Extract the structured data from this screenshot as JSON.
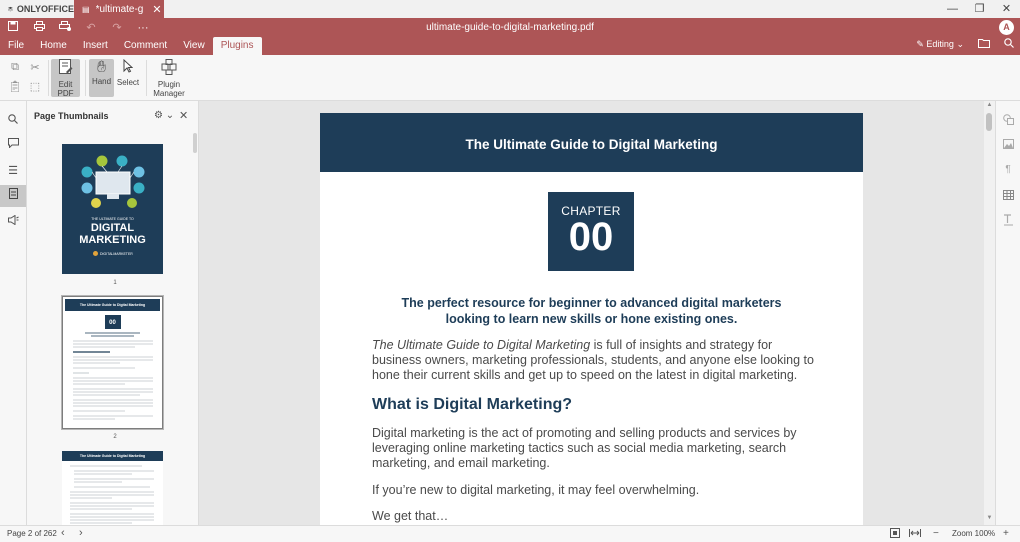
{
  "app": {
    "logo_text": "ONLYOFFICE",
    "tab_label": "*ultimate-g…",
    "doc_title": "ultimate-guide-to-digital-marketing.pdf",
    "avatar": "A",
    "window_controls": [
      "—",
      "❐",
      "✕"
    ]
  },
  "quick_access": [
    "save-icon",
    "print-icon",
    "quick-print-icon",
    "undo-icon",
    "redo-icon",
    "more-icon"
  ],
  "menu": {
    "items": [
      "File",
      "Home",
      "Insert",
      "Comment",
      "View",
      "Plugins"
    ],
    "active": "Plugins",
    "mode_label": "Editing"
  },
  "toolbar": {
    "edit_pdf": "Edit PDF",
    "hand": "Hand",
    "select": "Select",
    "plugin_manager": "Plugin Manager"
  },
  "thumbnails": {
    "title": "Page Thumbnails",
    "page_numbers": [
      "1",
      "2"
    ],
    "thumb1_title_small": "THE ULTIMATE GUIDE TO",
    "thumb1_title_big1": "DIGITAL",
    "thumb1_title_big2": "MARKETING",
    "thumb1_brand": "DIGITALMARKETER",
    "thumb_banner": "The Ultimate Guide to Digital Marketing"
  },
  "page": {
    "banner": "The Ultimate Guide to Digital Marketing",
    "chapter_label": "CHAPTER",
    "chapter_num": "00",
    "lead_line1": "The perfect resource for beginner to advanced digital marketers",
    "lead_line2": "looking to learn new skills or hone existing ones.",
    "p1_the": "The ",
    "p1_title": "Ultimate Guide to Digital Marketing",
    "p1_rest": " is full of insights and strategy for business owners, marketing professionals, students, and anyone else looking to hone their current skills and get up to speed on the latest in digital marketing.",
    "heading": "What is Digital Marketing?",
    "p2": "Digital marketing is the act of promoting and selling products and services by leveraging online marketing tactics such as social media marketing, search marketing, and email marketing.",
    "p3": "If you’re new to digital marketing, it may feel overwhelming.",
    "p4": "We get that…"
  },
  "status": {
    "page_info": "Page 2 of 262",
    "zoom": "Zoom 100%"
  },
  "colors": {
    "brand_red": "#ad5556",
    "navy": "#1e3d58"
  }
}
